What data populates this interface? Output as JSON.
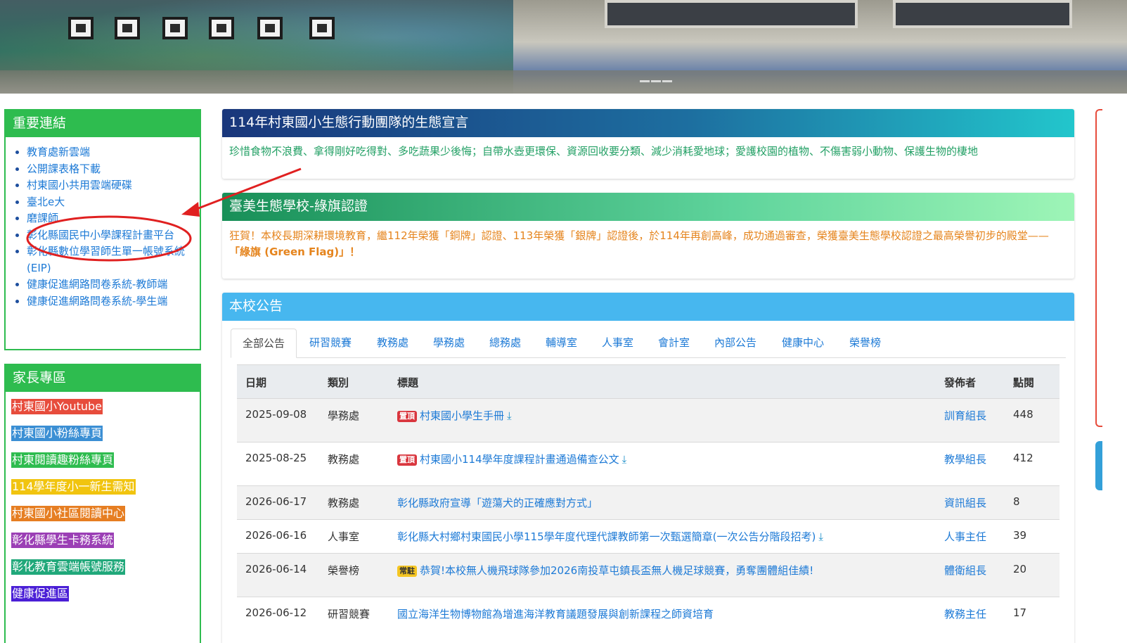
{
  "sidebar_links": {
    "title": "重要連結",
    "items": [
      "教育處新雲端",
      "公開課表格下載",
      "村東國小共用雲端硬碟",
      "臺北e大",
      "磨課師",
      "彰化縣國民中小學課程計畫平台",
      "彰化縣數位學習師生單一帳號系統 (EIP)",
      "健康促進網路問卷系統-教師端",
      "健康促進網路問卷系統-學生端"
    ]
  },
  "parents_zone": {
    "title": "家長專區",
    "items": [
      {
        "label": "村東國小Youtube",
        "color": "#e74c3c"
      },
      {
        "label": "村東國小粉絲專頁",
        "color": "#3b8fd4"
      },
      {
        "label": "村東閱讀趣粉絲專頁",
        "color": "#2ebc4f"
      },
      {
        "label": "114學年度小一新生需知",
        "color": "#f1c40f"
      },
      {
        "label": "村東國小社區閱讀中心",
        "color": "#e67e22"
      },
      {
        "label": "彰化縣學生卡務系統",
        "color": "#9b3fb5"
      },
      {
        "label": "彰化教育雲端帳號服務",
        "color": "#20a87a"
      },
      {
        "label": "健康促進區",
        "color": "#4a1fd6"
      }
    ]
  },
  "eco_declaration": {
    "title": "114年村東國小生態行動團隊的生態宣言",
    "body": "珍惜食物不浪費、拿得剛好吃得對、多吃蔬果少後悔；自帶水壺更環保、資源回收要分類、減少消耗愛地球；愛護校園的植物、不傷害弱小動物、保護生物的棲地"
  },
  "green_flag": {
    "title": "臺美生態學校-綠旗認證",
    "body": "狂賀！本校長期深耕環境教育，繼112年榮獲「銅牌」認證、113年榮獲「銀牌」認證後，於114年再創高峰，成功通過審查，榮獲臺美生態學校認證之最高榮譽初步的殿堂——",
    "highlight": "「綠旗 (Green Flag)」",
    "tail": "！"
  },
  "announcements": {
    "title": "本校公告",
    "tabs": [
      "全部公告",
      "研習競賽",
      "教務處",
      "學務處",
      "總務處",
      "輔導室",
      "人事室",
      "會計室",
      "內部公告",
      "健康中心",
      "榮譽榜"
    ],
    "active_tab": "全部公告",
    "columns": {
      "date": "日期",
      "category": "類別",
      "title": "標題",
      "author": "發佈者",
      "hits": "點閱"
    },
    "rows": [
      {
        "date": "2025-09-08",
        "category": "學務處",
        "badge": "置頂",
        "badge_color": "#d9363e",
        "title": "村東國小學生手冊",
        "download": true,
        "author": "訓育組長",
        "hits": "448"
      },
      {
        "date": "2025-08-25",
        "category": "教務處",
        "badge": "置頂",
        "badge_color": "#d9363e",
        "title": "村東國小114學年度課程計畫通過備查公文",
        "download": true,
        "author": "教學組長",
        "hits": "412"
      },
      {
        "date": "2026-06-17",
        "category": "教務處",
        "badge": "",
        "title": "彰化縣政府宣導「遊蕩犬的正確應對方式」",
        "download": false,
        "author": "資訊組長",
        "hits": "8"
      },
      {
        "date": "2026-06-16",
        "category": "人事室",
        "badge": "",
        "title": "彰化縣大村鄉村東國民小學115學年度代理代課教師第一次甄選簡章(一次公告分階段招考)",
        "download": true,
        "author": "人事主任",
        "hits": "39"
      },
      {
        "date": "2026-06-14",
        "category": "榮譽榜",
        "badge": "常駐",
        "badge_color": "#f5c623",
        "title": "恭賀!本校無人機飛球隊參加2026南投草屯鎮長盃無人機足球競賽，勇奪團體組佳績!",
        "download": false,
        "author": "體衛組長",
        "hits": "20"
      },
      {
        "date": "2026-06-12",
        "category": "研習競賽",
        "badge": "",
        "title": "國立海洋生物博物館為增進海洋教育議題發展與創新課程之師資培育",
        "download": false,
        "author": "教務主任",
        "hits": "17"
      }
    ]
  },
  "annotation": {
    "arrow_color": "#e02020",
    "target": "彰化縣國民中小學課程計畫平台"
  }
}
